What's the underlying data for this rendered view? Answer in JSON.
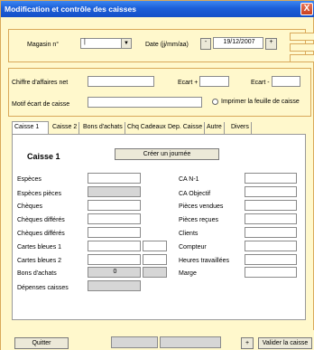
{
  "window": {
    "title": "Modification et contrôle des caisses",
    "close_glyph": "X"
  },
  "header": {
    "magasin_label": "Magasin n°",
    "magasin_value": "|",
    "date_label": "Date (jj/mm/aa)",
    "date_minus": "-",
    "date_value": "19/12/2007",
    "date_plus": "+"
  },
  "middle": {
    "ca_net_label": "Chiffre d'affaires net",
    "ecart_plus_label": "Ecart +",
    "ecart_minus_label": "Ecart -",
    "motif_label": "Motif écart de caisse",
    "print_label": "Imprimer la feuille de caisse"
  },
  "tabs": [
    "Caisse 1",
    "Caisse 2",
    "Bons d'achats",
    "Chq Cadeaux",
    "Dep. Caisse",
    "Autre",
    "Divers"
  ],
  "caisse": {
    "title": "Caisse 1",
    "create_button": "Créer un journée",
    "left_fields": [
      "Espèces",
      "Espèces pièces",
      "Chèques",
      "Chèques différés",
      "Chèques différés",
      "Cartes bleues 1",
      "Cartes bleues 2",
      "Bons d'achats",
      "Dépenses caisses"
    ],
    "bons_value": "0",
    "right_fields": [
      "CA N-1",
      "CA Objectif",
      "Pièces vendues",
      "Pièces reçues",
      "Clients",
      "Compteur",
      "Heures travaillées",
      "Marge"
    ]
  },
  "footer": {
    "quit_label": "Quitter",
    "plus_label": "+",
    "validate_label": "Valider la caisse"
  }
}
